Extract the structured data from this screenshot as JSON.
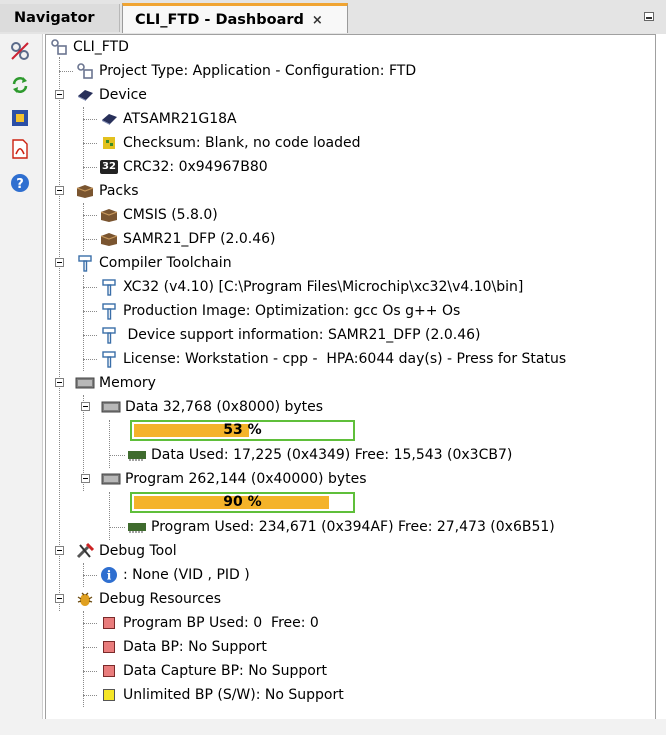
{
  "tabs": {
    "navigator": "Navigator",
    "dashboard": "CLI_FTD - Dashboard",
    "close": "×"
  },
  "tree": {
    "root": "CLI_FTD",
    "project_type": "Project Type: Application - Configuration: FTD",
    "device": {
      "label": "Device",
      "name": "ATSAMR21G18A",
      "checksum": "Checksum: Blank, no code loaded",
      "crc": "CRC32: 0x94967B80",
      "crc_badge": "32"
    },
    "packs": {
      "label": "Packs",
      "items": [
        "CMSIS (5.8.0)",
        "SAMR21_DFP (2.0.46)"
      ]
    },
    "compiler": {
      "label": "Compiler Toolchain",
      "items": [
        "XC32 (v4.10) [C:\\Program Files\\Microchip\\xc32\\v4.10\\bin]",
        "Production Image: Optimization: gcc Os g++ Os",
        " Device support information: SAMR21_DFP (2.0.46)",
        "License: Workstation - cpp -  HPA:6044 day(s) - Press for Status"
      ]
    },
    "memory": {
      "label": "Memory",
      "data": {
        "label": "Data 32,768 (0x8000) bytes",
        "percent_text": "53 %",
        "percent": 53,
        "used": "Data Used: 17,225 (0x4349) Free: 15,543 (0x3CB7)"
      },
      "program": {
        "label": "Program 262,144 (0x40000) bytes",
        "percent_text": "90 %",
        "percent": 90,
        "used": "Program Used: 234,671 (0x394AF) Free: 27,473 (0x6B51)"
      }
    },
    "debug_tool": {
      "label": "Debug Tool",
      "item": ": None (VID , PID )"
    },
    "debug_resources": {
      "label": "Debug Resources",
      "items": [
        "Program BP Used: 0  Free: 0",
        "Data BP: No Support",
        "Data Capture BP: No Support",
        "Unlimited BP (S/W): No Support"
      ]
    }
  },
  "colors": {
    "accent_tab": "#f0a432",
    "progress_fill": "#f4b32a",
    "progress_border": "#5fbf3a"
  }
}
